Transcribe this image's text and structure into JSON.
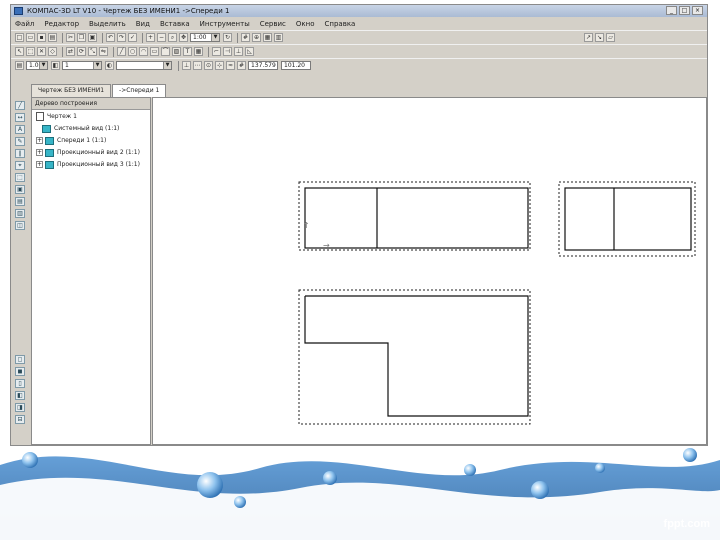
{
  "window": {
    "title": "КОМПАС-3D LT V10 - Чертеж БЕЗ ИМЕНИ1 ->Спереди 1"
  },
  "menu": [
    "Файл",
    "Редактор",
    "Выделить",
    "Вид",
    "Вставка",
    "Инструменты",
    "Сервис",
    "Окно",
    "Справка"
  ],
  "toolbar": {
    "scale_value": "1:00",
    "state_combo_1": "1.0",
    "state_combo_2": "1",
    "coord_x": "137.579",
    "coord_y": "101.20"
  },
  "tabs": [
    {
      "label": "Чертеж БЕЗ ИМЕНИ1"
    },
    {
      "label": "->Спереди 1"
    }
  ],
  "tree": {
    "header": "Дерево построения",
    "root": "Чертеж 1",
    "items": [
      {
        "label": "Системный вид (1:1)"
      },
      {
        "label": "Спереди 1 (1:1)"
      },
      {
        "label": "Проекционный вид 2 (1:1)"
      },
      {
        "label": "Проекционный вид 3 (1:1)"
      }
    ]
  },
  "watermark": "fppt.com",
  "colors": {
    "ui_gray": "#d4d0c8",
    "tree_icon": "#37b5c7",
    "water_blue": "#2e6fb0"
  }
}
